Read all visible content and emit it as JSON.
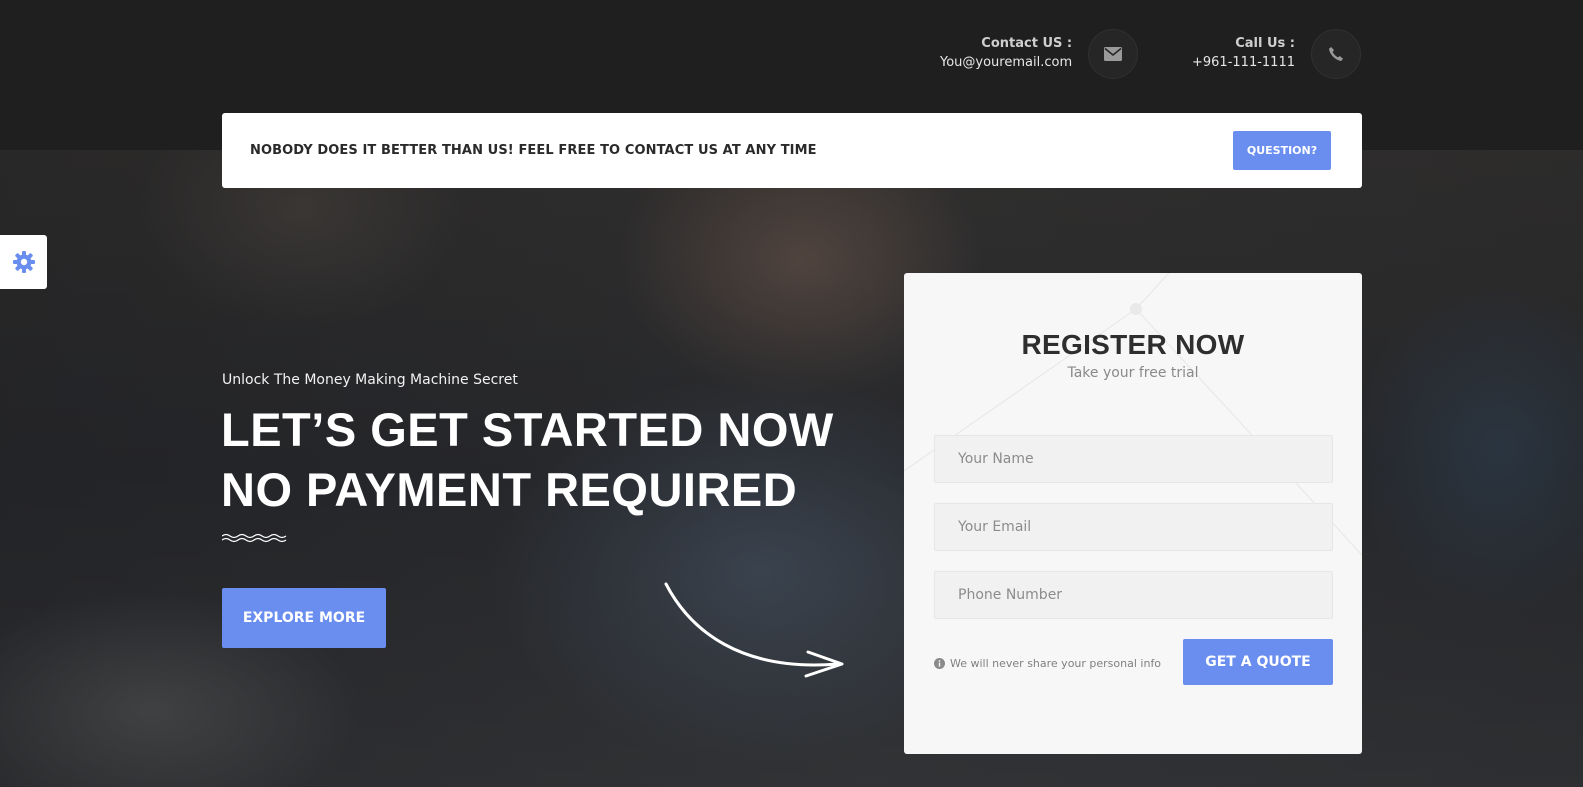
{
  "header": {
    "contact": {
      "label": "Contact US :",
      "value": "You@youremail.com",
      "icon": "envelope-icon"
    },
    "call": {
      "label": "Call Us :",
      "value": "+961-111-1111",
      "icon": "phone-icon"
    }
  },
  "notice": {
    "text": "NOBODY DOES IT BETTER THAN US! FEEL FREE TO CONTACT US AT ANY TIME",
    "button_label": "QUESTION?"
  },
  "settings": {
    "icon": "gear-icon"
  },
  "hero": {
    "tagline": "Unlock The Money Making Machine Secret",
    "headline_line1": "LET’S GET STARTED NOW",
    "headline_line2": "NO PAYMENT REQUIRED",
    "button_label": "EXPLORE MORE"
  },
  "register": {
    "title": "REGISTER NOW",
    "subtitle": "Take your free trial",
    "name_placeholder": "Your Name",
    "email_placeholder": "Your Email",
    "phone_placeholder": "Phone Number",
    "privacy_note": "We will never share your personal info",
    "submit_label": "GET A QUOTE"
  },
  "colors": {
    "accent": "#6a8ef0",
    "topbar": "#1f1f1f",
    "card": "#f7f7f7"
  }
}
